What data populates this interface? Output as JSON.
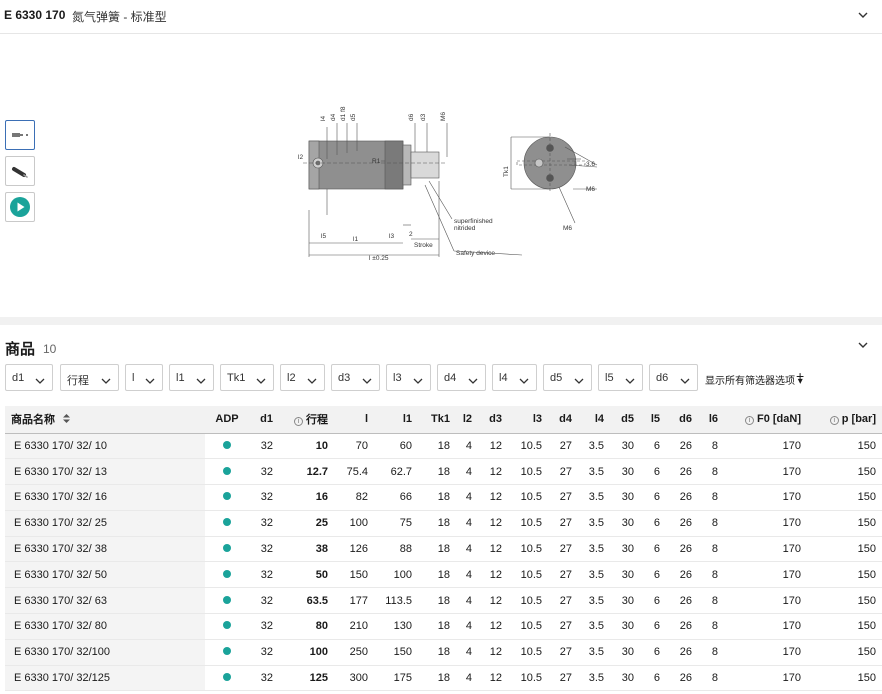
{
  "header": {
    "code": "E 6330 170",
    "name": "氮气弹簧 - 标准型"
  },
  "media": {
    "thumbnails": [
      "drawing-thumbnail",
      "product-photo-thumbnail",
      "play-video-icon"
    ],
    "drawing_labels": {
      "l2": "l2",
      "l4": "l4",
      "d4": "d4",
      "d1": "d1 f8",
      "d5": "d5",
      "r1": "R1",
      "d6": "d6",
      "d3": "d3",
      "m6a": "M6",
      "l5": "l5",
      "l1": "l1",
      "l3": "l3",
      "two": "2",
      "stroke": "Stroke",
      "l": "l ±0.25",
      "superfinished": "superfinished",
      "nitrided": "nitrided",
      "safety": "Safety device",
      "tk1": "Tk1",
      "dim36": "3.6",
      "m6b": "M6",
      "m6c": "M6"
    }
  },
  "products": {
    "title": "商品",
    "count": "10",
    "filters": [
      "d1",
      "行程",
      "l",
      "l1",
      "Tk1",
      "l2",
      "d3",
      "l3",
      "d4",
      "l4",
      "d5",
      "l5",
      "d6"
    ],
    "show_all": "显示所有筛选器选项",
    "show_all_arrow": "▾",
    "plus": "+",
    "columns": {
      "name": "商品名称",
      "adp": "ADP",
      "d1": "d1",
      "stroke": "行程",
      "l": "l",
      "l1": "l1",
      "tk1": "Tk1",
      "l2": "l2",
      "d3": "d3",
      "l3": "l3",
      "d4": "d4",
      "l4": "l4",
      "d5": "d5",
      "l5": "l5",
      "d6": "d6",
      "l6": "l6",
      "f0": "F0 [daN]",
      "p": "p [bar]",
      "info": "i"
    },
    "rows": [
      {
        "name": "E 6330 170/ 32/ 10",
        "d1": "32",
        "stroke": "10",
        "l": "70",
        "l1": "60",
        "tk1": "18",
        "l2": "4",
        "d3": "12",
        "l3": "10.5",
        "d4": "27",
        "l4": "3.5",
        "d5": "30",
        "l5": "6",
        "d6": "26",
        "l6": "8",
        "f0": "170",
        "p": "150"
      },
      {
        "name": "E 6330 170/ 32/ 13",
        "d1": "32",
        "stroke": "12.7",
        "l": "75.4",
        "l1": "62.7",
        "tk1": "18",
        "l2": "4",
        "d3": "12",
        "l3": "10.5",
        "d4": "27",
        "l4": "3.5",
        "d5": "30",
        "l5": "6",
        "d6": "26",
        "l6": "8",
        "f0": "170",
        "p": "150"
      },
      {
        "name": "E 6330 170/ 32/ 16",
        "d1": "32",
        "stroke": "16",
        "l": "82",
        "l1": "66",
        "tk1": "18",
        "l2": "4",
        "d3": "12",
        "l3": "10.5",
        "d4": "27",
        "l4": "3.5",
        "d5": "30",
        "l5": "6",
        "d6": "26",
        "l6": "8",
        "f0": "170",
        "p": "150"
      },
      {
        "name": "E 6330 170/ 32/ 25",
        "d1": "32",
        "stroke": "25",
        "l": "100",
        "l1": "75",
        "tk1": "18",
        "l2": "4",
        "d3": "12",
        "l3": "10.5",
        "d4": "27",
        "l4": "3.5",
        "d5": "30",
        "l5": "6",
        "d6": "26",
        "l6": "8",
        "f0": "170",
        "p": "150"
      },
      {
        "name": "E 6330 170/ 32/ 38",
        "d1": "32",
        "stroke": "38",
        "l": "126",
        "l1": "88",
        "tk1": "18",
        "l2": "4",
        "d3": "12",
        "l3": "10.5",
        "d4": "27",
        "l4": "3.5",
        "d5": "30",
        "l5": "6",
        "d6": "26",
        "l6": "8",
        "f0": "170",
        "p": "150"
      },
      {
        "name": "E 6330 170/ 32/ 50",
        "d1": "32",
        "stroke": "50",
        "l": "150",
        "l1": "100",
        "tk1": "18",
        "l2": "4",
        "d3": "12",
        "l3": "10.5",
        "d4": "27",
        "l4": "3.5",
        "d5": "30",
        "l5": "6",
        "d6": "26",
        "l6": "8",
        "f0": "170",
        "p": "150"
      },
      {
        "name": "E 6330 170/ 32/ 63",
        "d1": "32",
        "stroke": "63.5",
        "l": "177",
        "l1": "113.5",
        "tk1": "18",
        "l2": "4",
        "d3": "12",
        "l3": "10.5",
        "d4": "27",
        "l4": "3.5",
        "d5": "30",
        "l5": "6",
        "d6": "26",
        "l6": "8",
        "f0": "170",
        "p": "150"
      },
      {
        "name": "E 6330 170/ 32/ 80",
        "d1": "32",
        "stroke": "80",
        "l": "210",
        "l1": "130",
        "tk1": "18",
        "l2": "4",
        "d3": "12",
        "l3": "10.5",
        "d4": "27",
        "l4": "3.5",
        "d5": "30",
        "l5": "6",
        "d6": "26",
        "l6": "8",
        "f0": "170",
        "p": "150"
      },
      {
        "name": "E 6330 170/ 32/100",
        "d1": "32",
        "stroke": "100",
        "l": "250",
        "l1": "150",
        "tk1": "18",
        "l2": "4",
        "d3": "12",
        "l3": "10.5",
        "d4": "27",
        "l4": "3.5",
        "d5": "30",
        "l5": "6",
        "d6": "26",
        "l6": "8",
        "f0": "170",
        "p": "150"
      },
      {
        "name": "E 6330 170/ 32/125",
        "d1": "32",
        "stroke": "125",
        "l": "300",
        "l1": "175",
        "tk1": "18",
        "l2": "4",
        "d3": "12",
        "l3": "10.5",
        "d4": "27",
        "l4": "3.5",
        "d5": "30",
        "l5": "6",
        "d6": "26",
        "l6": "8",
        "f0": "170",
        "p": "150"
      }
    ]
  },
  "colors": {
    "adp_dot": "#1aa39a",
    "video_icon": "#1aa39a",
    "active_thumb_border": "#3b6fb5"
  }
}
